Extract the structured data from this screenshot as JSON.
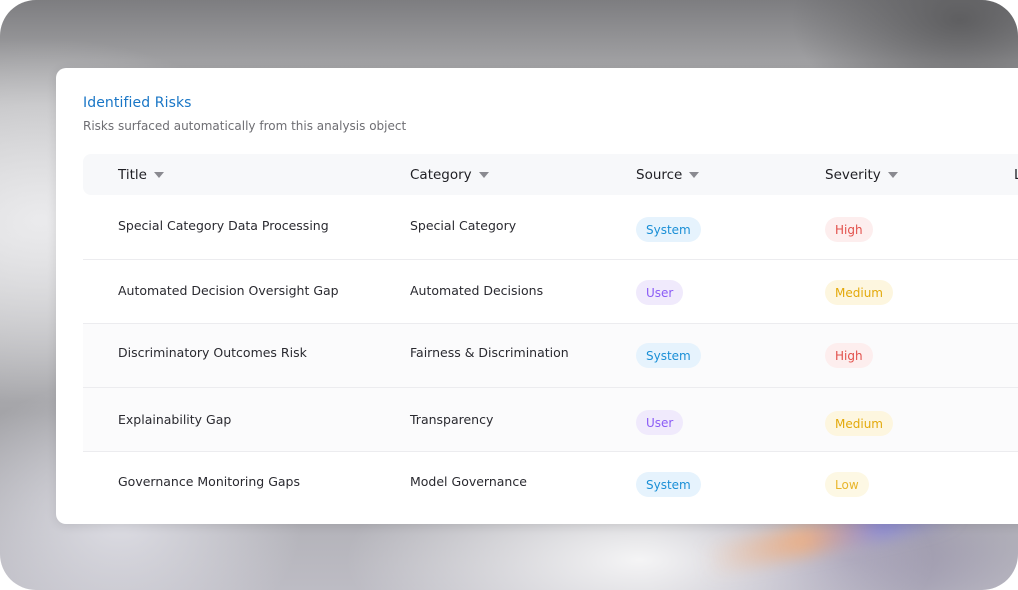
{
  "panel": {
    "title": "Identified Risks",
    "subtitle": "Risks surfaced automatically from this analysis object"
  },
  "columns": {
    "title": "Title",
    "category": "Category",
    "source": "Source",
    "severity": "Severity",
    "next_partial": "L"
  },
  "rows": [
    {
      "title": "Special Category Data Processing",
      "category": "Special Category",
      "source": "System",
      "severity": "High"
    },
    {
      "title": "Automated Decision Oversight Gap",
      "category": "Automated Decisions",
      "source": "User",
      "severity": "Medium"
    },
    {
      "title": "Discriminatory Outcomes Risk",
      "category": "Fairness & Discrimination",
      "source": "System",
      "severity": "High"
    },
    {
      "title": "Explainability Gap",
      "category": "Transparency",
      "source": "User",
      "severity": "Medium"
    },
    {
      "title": "Governance Monitoring Gaps",
      "category": "Model Governance",
      "source": "System",
      "severity": "Low"
    }
  ],
  "colors": {
    "title_accent": "#1976c6",
    "system_pill": "#1a8fd6",
    "user_pill": "#8b5cf6",
    "high_pill": "#e2504b",
    "medium_pill": "#e3a90b",
    "low_pill": "#e8b52a"
  },
  "icons": {
    "sort": "caret-down-icon"
  }
}
